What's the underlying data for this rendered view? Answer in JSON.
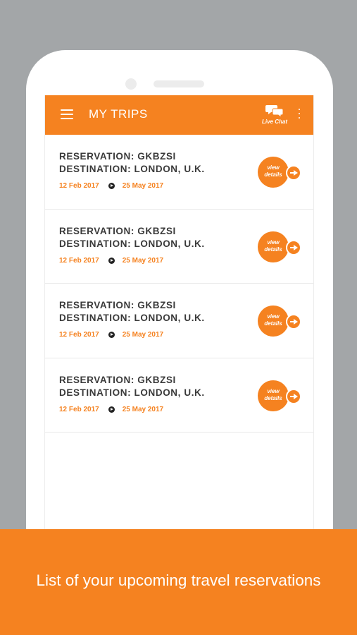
{
  "app_bar": {
    "title": "MY TRIPS",
    "live_chat_label": "Live Chat",
    "icons": [
      "menu-icon",
      "chat-bubbles-icon",
      "more-vertical-icon"
    ],
    "accent_color": "#f58220"
  },
  "trips": [
    {
      "reservation": "RESERVATION: GKBZSI",
      "destination": "DESTINATION: LONDON, U.K.",
      "start_date": "12 Feb 2017",
      "end_date": "25 May 2017",
      "action_line1": "view",
      "action_line2": "details"
    },
    {
      "reservation": "RESERVATION: GKBZSI",
      "destination": "DESTINATION: LONDON, U.K.",
      "start_date": "12 Feb 2017",
      "end_date": "25 May 2017",
      "action_line1": "view",
      "action_line2": "details"
    },
    {
      "reservation": "RESERVATION: GKBZSI",
      "destination": "DESTINATION: LONDON, U.K.",
      "start_date": "12 Feb 2017",
      "end_date": "25 May 2017",
      "action_line1": "view",
      "action_line2": "details"
    },
    {
      "reservation": "RESERVATION: GKBZSI",
      "destination": "DESTINATION: LONDON, U.K.",
      "start_date": "12 Feb 2017",
      "end_date": "25 May 2017",
      "action_line1": "view",
      "action_line2": "details"
    }
  ],
  "banner": {
    "caption": "List of your upcoming travel reservations"
  }
}
